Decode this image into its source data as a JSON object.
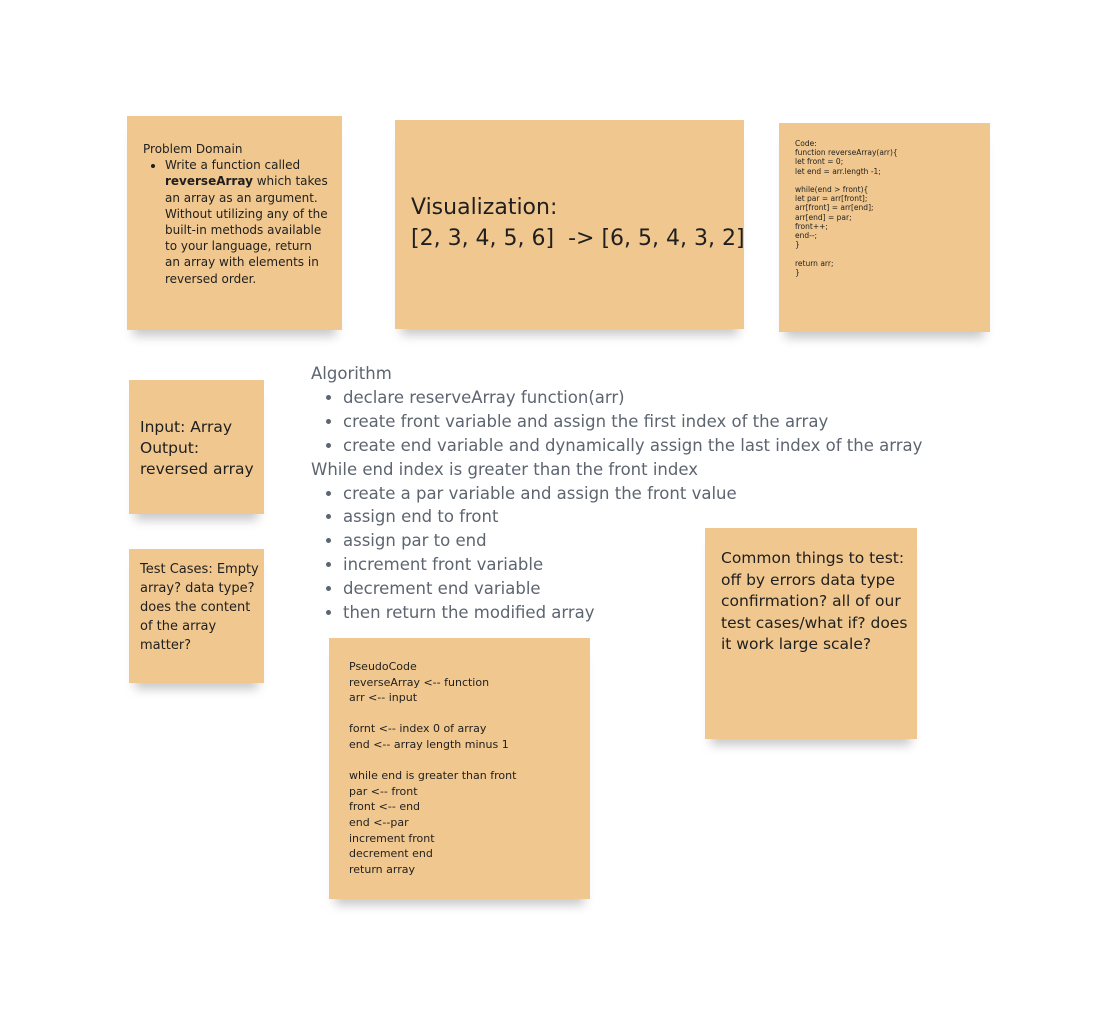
{
  "problem": {
    "title": "Problem Domain",
    "bullet_pre": "Write a function called ",
    "bullet_bold": "reverseArray",
    "bullet_post": " which takes an array as an argument. Without utilizing any of the built-in methods available to your language, return an array with elements in reversed order."
  },
  "visualization": {
    "title": "Visualization:",
    "example": "[2, 3, 4, 5, 6]  -> [6, 5, 4, 3, 2]"
  },
  "code": {
    "lines": [
      "Code:",
      "function reverseArray(arr){",
      "let front = 0;",
      "let end = arr.length -1;",
      "",
      "while(end > front){",
      "let par = arr[front];",
      "arr[front] = arr[end];",
      "arr[end] = par;",
      "front++;",
      "end--;",
      "}",
      "",
      "return arr;",
      "}"
    ]
  },
  "io": {
    "input": "Input: Array",
    "output": "Output:",
    "output_value": "reversed array"
  },
  "tests": {
    "text": "Test Cases: Empty array? data type? does the content of the array matter?"
  },
  "common": {
    "text": "Common things to test: off by errors data type confirmation? all of our test cases/what if? does it work large scale?"
  },
  "algorithm": {
    "title": "Algorithm",
    "steps": [
      "declare reserveArray function(arr)",
      "create front variable and assign the first index of the array",
      "create end variable and dynamically assign the last index of the array"
    ],
    "loop_title": "While end index is greater than the front index",
    "loop_steps": [
      "create a par variable and assign the front value",
      "assign end to front",
      "assign par to end",
      "increment front variable",
      "decrement end variable",
      "then return the modified array"
    ]
  },
  "pseudocode": {
    "lines": [
      "PseudoCode",
      "reverseArray <-- function",
      "arr <-- input",
      "",
      "fornt <-- index 0 of array",
      "end <-- array length minus 1",
      "",
      "while end is greater than front",
      "par <-- front",
      "front <-- end",
      "end <--par",
      "increment front",
      "decrement end",
      "return array"
    ]
  }
}
